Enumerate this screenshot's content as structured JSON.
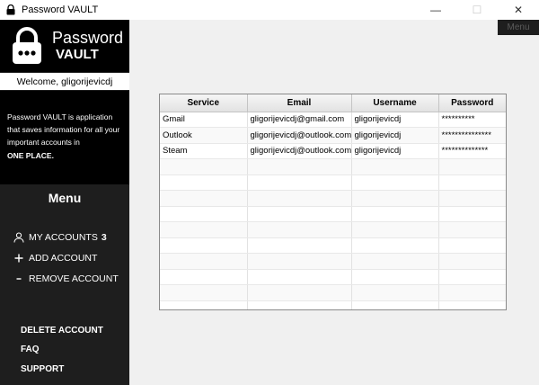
{
  "window": {
    "title": "Password VAULT",
    "minimize": "—",
    "maximize": "☐",
    "close": "✕"
  },
  "brand": {
    "line1": "Password",
    "line2": "VAULT"
  },
  "welcome": "Welcome,  gligorijevicdj",
  "description": {
    "text": "Password VAULT is application that saves information for all your important accounts in",
    "strong": "ONE PLACE."
  },
  "menu": {
    "title": "Menu",
    "items": [
      {
        "label": "MY ACCOUNTS",
        "count": "3",
        "icon": "person-icon"
      },
      {
        "label": "ADD ACCOUNT",
        "icon": "plus-icon"
      },
      {
        "label": "REMOVE ACCOUNT",
        "icon": "minus-icon"
      }
    ],
    "bottom": [
      "DELETE ACCOUNT",
      "FAQ",
      "SUPPORT"
    ]
  },
  "top_menu_button": "Menu",
  "table": {
    "columns": [
      "Service",
      "Email",
      "Username",
      "Password"
    ],
    "rows": [
      [
        "Gmail",
        "gligorijevicdj@gmail.com",
        "gligorijevicdj",
        "**********"
      ],
      [
        "Outlook",
        "gligorijevicdj@outlook.com",
        "gligorijevicdj",
        "***************"
      ],
      [
        "Steam",
        "gligorijevicdj@outlook.com",
        "gligorijevicdj",
        "**************"
      ]
    ],
    "empty_rows": 10
  }
}
